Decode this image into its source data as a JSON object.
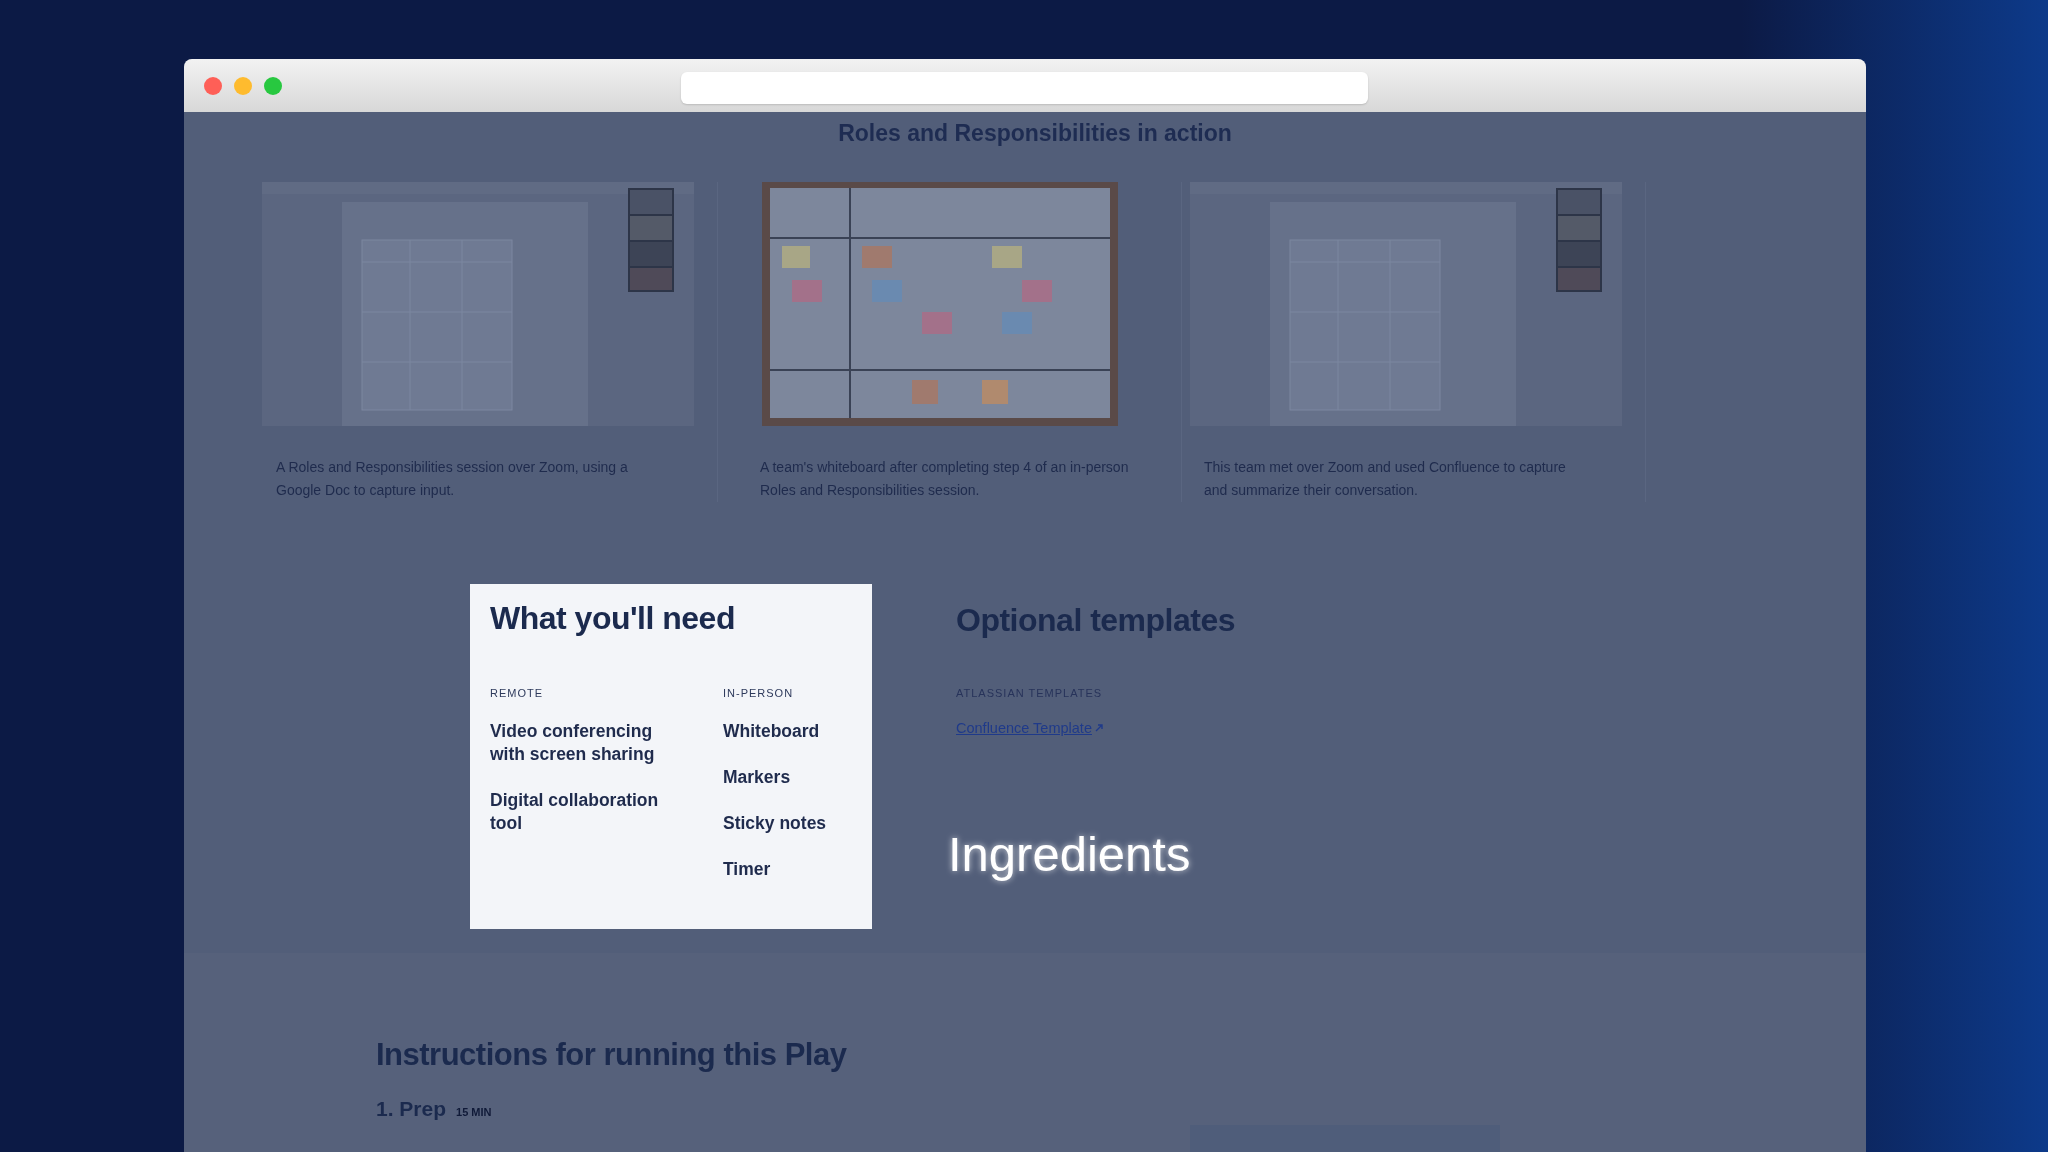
{
  "browser": {
    "buttons": [
      {
        "color": "#fe5f57"
      },
      {
        "color": "#febb2e"
      },
      {
        "color": "#28c840"
      }
    ]
  },
  "gallery": {
    "title": "Roles and Responsibilities in action",
    "items": [
      {
        "kind": "doc",
        "caption": "A Roles and Responsibilities session over Zoom, using a Google Doc to capture input."
      },
      {
        "kind": "whiteboard",
        "caption": "A team's whiteboard after completing step 4 of an in-person Roles and Responsibilities session."
      },
      {
        "kind": "doc",
        "caption": "This team met over Zoom and used Confluence to capture and summarize their conversation."
      }
    ]
  },
  "needs": {
    "title": "What you'll need",
    "columns": [
      {
        "heading": "REMOTE",
        "items": [
          "Video conferencing with screen sharing",
          "Digital collaboration tool"
        ]
      },
      {
        "heading": "IN-PERSON",
        "items": [
          "Whiteboard",
          "Markers",
          "Sticky notes",
          "Timer"
        ]
      }
    ]
  },
  "templates": {
    "title": "Optional templates",
    "group_label": "ATLASSIAN TEMPLATES",
    "link": "Confluence Template"
  },
  "overlay_caption": "Ingredients",
  "instructions": {
    "title": "Instructions for running this Play",
    "steps": [
      {
        "label": "1. Prep",
        "duration": "15 MIN"
      }
    ]
  }
}
